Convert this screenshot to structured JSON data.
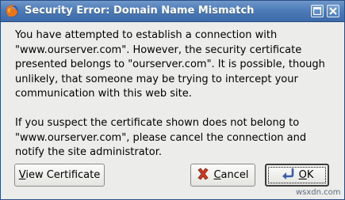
{
  "window": {
    "title": "Security Error: Domain Name Mismatch",
    "icons": {
      "app": "firefox-icon",
      "maximize": "maximize-icon",
      "close": "close-icon"
    }
  },
  "message": {
    "paragraph_1_lines": [
      "You have attempted to establish a connection with",
      "\"www.ourserver.com\". However, the security certificate",
      "presented belongs to \"ourserver.com\". It is possible, though",
      "unlikely, that someone may be trying to intercept your",
      "communication with this web site."
    ],
    "paragraph_2_lines": [
      "If you suspect the certificate shown does not belong to",
      "\"www.ourserver.com\", please cancel the connection and",
      "notify the site administrator."
    ]
  },
  "buttons": {
    "view_certificate": {
      "mnemonic": "V",
      "rest": "iew Certificate"
    },
    "cancel": {
      "mnemonic": "C",
      "rest": "ancel",
      "icon": "cancel-x-icon"
    },
    "ok": {
      "mnemonic": "O",
      "rest": "K",
      "icon": "enter-arrow-icon"
    }
  },
  "watermark": "wsxdn.com",
  "colors": {
    "titlebar": "#4d7cb8",
    "dialog_bg": "#ececea",
    "cancel_icon": "#cc3a1f"
  }
}
